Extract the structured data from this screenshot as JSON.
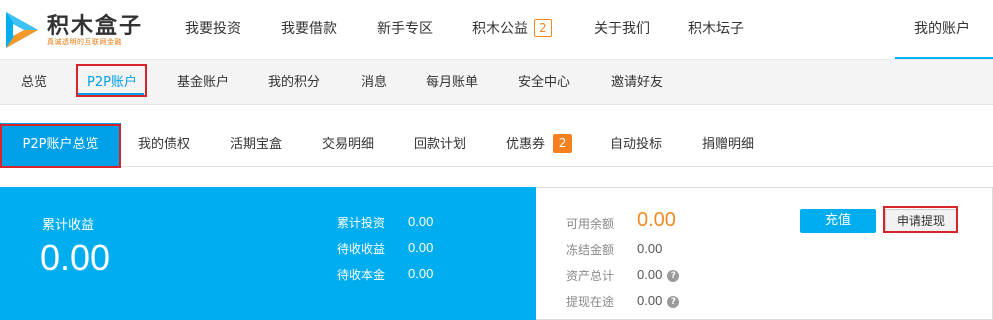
{
  "brand": {
    "name": "积木盒子",
    "slogan": "真诚透明的互联网金融",
    "logo_icon": "triangle-play-logo",
    "accent_color": "#00adef"
  },
  "top_nav": [
    {
      "label": "我要投资"
    },
    {
      "label": "我要借款"
    },
    {
      "label": "新手专区"
    },
    {
      "label": "积木公益",
      "badge": "2"
    },
    {
      "label": "关于我们"
    },
    {
      "label": "积木坛子"
    },
    {
      "label": "我的账户",
      "active": true
    }
  ],
  "sub_nav": [
    {
      "label": "总览"
    },
    {
      "label": "P2P账户",
      "active": true
    },
    {
      "label": "基金账户"
    },
    {
      "label": "我的积分"
    },
    {
      "label": "消息"
    },
    {
      "label": "每月账单"
    },
    {
      "label": "安全中心"
    },
    {
      "label": "邀请好友"
    }
  ],
  "tabs": [
    {
      "label": "P2P账户总览",
      "active": true
    },
    {
      "label": "我的债权"
    },
    {
      "label": "活期宝盒"
    },
    {
      "label": "交易明细"
    },
    {
      "label": "回款计划"
    },
    {
      "label": "优惠券",
      "badge": "2"
    },
    {
      "label": "自动投标"
    },
    {
      "label": "捐赠明细"
    }
  ],
  "summary": {
    "cumulative_income": {
      "label": "累计收益",
      "value": "0.00"
    },
    "stats": [
      {
        "label": "累计投资",
        "value": "0.00"
      },
      {
        "label": "待收收益",
        "value": "0.00"
      },
      {
        "label": "待收本金",
        "value": "0.00"
      }
    ],
    "balances": [
      {
        "label": "可用余额",
        "value": "0.00",
        "highlight": true
      },
      {
        "label": "冻结金额",
        "value": "0.00"
      },
      {
        "label": "资产总计",
        "value": "0.00",
        "help": true
      },
      {
        "label": "提现在途",
        "value": "0.00",
        "help": true
      }
    ],
    "help_glyph": "?",
    "recharge_label": "充值",
    "withdraw_label": "申请提现"
  }
}
